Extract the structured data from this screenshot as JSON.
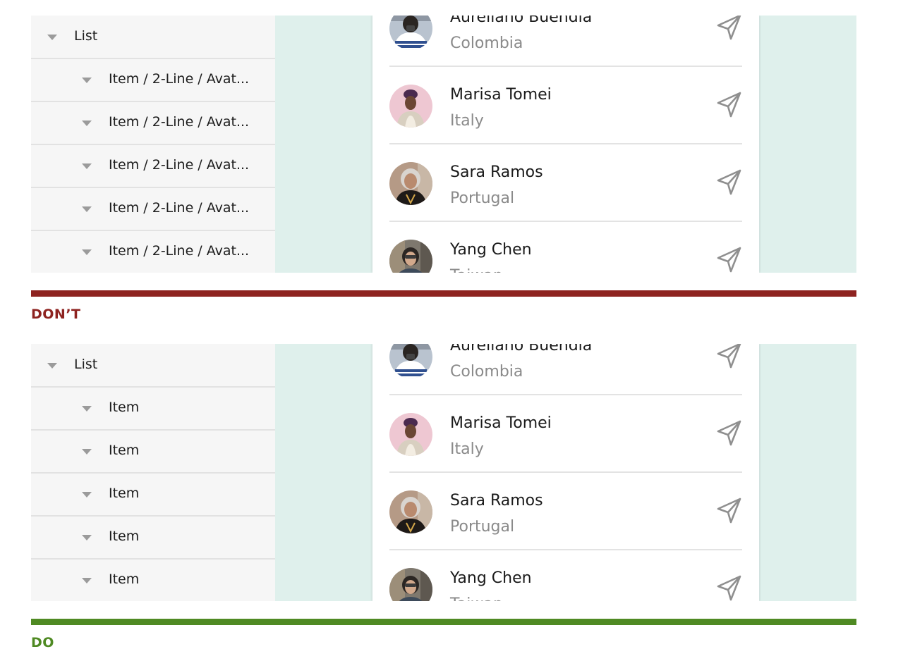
{
  "colors": {
    "dont": "#8e2320",
    "do": "#4f8a23",
    "canvas": "#dff0ec",
    "layers_panel": "#f6f6f6"
  },
  "dont_example": {
    "label": "DON’T",
    "layers": {
      "parent": "List",
      "children": [
        "Item / 2-Line / Avat...",
        "Item / 2-Line / Avat...",
        "Item / 2-Line / Avat...",
        "Item / 2-Line / Avat...",
        "Item / 2-Line / Avat..."
      ]
    }
  },
  "do_example": {
    "label": "DO",
    "layers": {
      "parent": "List",
      "children": [
        "Item",
        "Item",
        "Item",
        "Item",
        "Item"
      ]
    }
  },
  "contacts": [
    {
      "name": "Aureliano Buendía",
      "country": "Colombia",
      "avatar_icon": "person-photo-avatar",
      "action_icon": "send-icon"
    },
    {
      "name": "Marisa Tomei",
      "country": "Italy",
      "avatar_icon": "person-photo-avatar",
      "action_icon": "send-icon"
    },
    {
      "name": "Sara Ramos",
      "country": "Portugal",
      "avatar_icon": "person-photo-avatar",
      "action_icon": "send-icon"
    },
    {
      "name": "Yang Chen",
      "country": "Taiwan",
      "avatar_icon": "person-photo-avatar",
      "action_icon": "send-icon"
    }
  ]
}
